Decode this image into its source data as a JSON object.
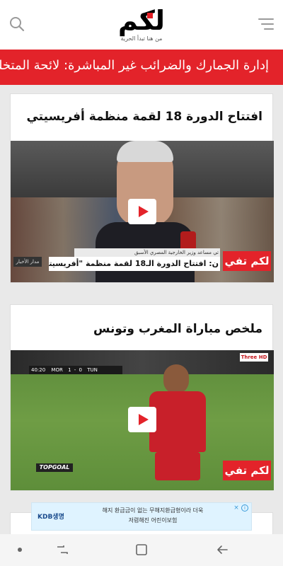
{
  "header": {
    "logo_text": "لكم",
    "logo_tagline": "من هنا تبدأ الحرية"
  },
  "ticker": {
    "text": "إدارة الجمارك والضرائب غير المباشرة: لائحة المتخلفين عن ا"
  },
  "cards": [
    {
      "title": "افتتاح الدورة 18 لقمة منظمة أفريسيتي",
      "badge": "لكم تفي",
      "lower_third": "ن: افتتاح الدورة الـ18 لقمة منظمة \"أفريسيتي\"",
      "lower_third_sub": "تي مساعد وزير الخارجية المصري الأسبق",
      "channel_tag": "مدار الأخبار"
    },
    {
      "title": "ملخص مباراة المغرب وتونس",
      "badge": "لكم تفي",
      "score": {
        "time": "40:20",
        "home": "MOR",
        "home_score": "1",
        "away_score": "0",
        "away": "TUN"
      },
      "broadcaster": "TOPGOAL",
      "channel_logo": "Three HD"
    }
  ],
  "ad": {
    "text": "해지 환급금이 없는 무해지환급형이라 더욱 저렴해진 어린이보험",
    "brand": "KDB생명"
  },
  "navbar": {
    "dot_icon": "dot-icon",
    "recent_icon": "recent-apps-icon",
    "home_icon": "home-icon",
    "back_icon": "back-icon"
  }
}
